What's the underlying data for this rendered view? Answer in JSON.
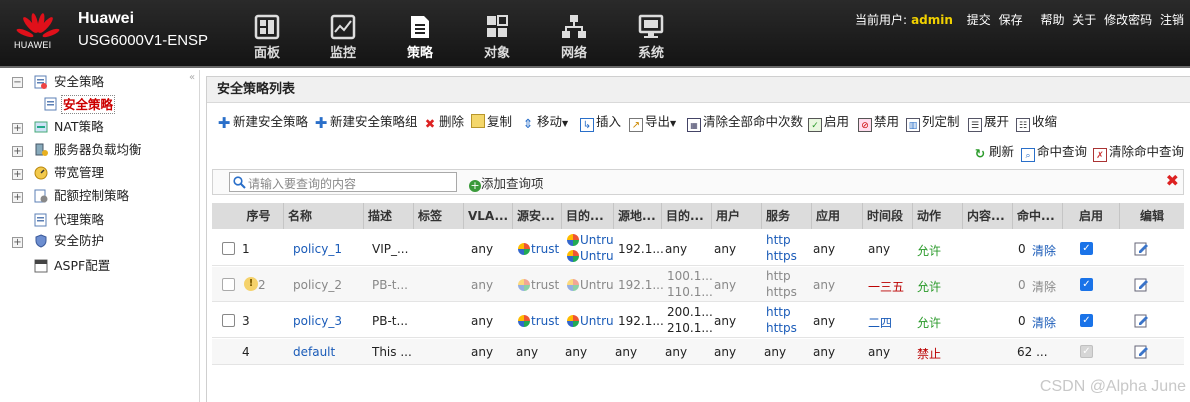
{
  "header": {
    "logo_text": "HUAWEI",
    "brand": "Huawei",
    "model": "USG6000V1-ENSP",
    "nav": [
      {
        "label": "面板",
        "icon": "dashboard-icon"
      },
      {
        "label": "监控",
        "icon": "monitor-icon"
      },
      {
        "label": "策略",
        "icon": "policy-icon"
      },
      {
        "label": "对象",
        "icon": "object-icon"
      },
      {
        "label": "网络",
        "icon": "network-icon"
      },
      {
        "label": "系统",
        "icon": "system-icon"
      }
    ],
    "current_user_label": "当前用户:",
    "current_user": "admin",
    "links": [
      "提交",
      "保存",
      "帮助",
      "关于",
      "修改密码",
      "注销"
    ]
  },
  "sidebar": {
    "items": [
      {
        "label": "安全策略",
        "expander": "−"
      },
      {
        "label": "安全策略",
        "selected": true
      },
      {
        "label": "NAT策略",
        "expander": "+"
      },
      {
        "label": "服务器负载均衡",
        "expander": "+"
      },
      {
        "label": "带宽管理",
        "expander": "+"
      },
      {
        "label": "配额控制策略",
        "expander": "+"
      },
      {
        "label": "代理策略",
        "expander": ""
      },
      {
        "label": "安全防护",
        "expander": "+"
      },
      {
        "label": "ASPF配置",
        "expander": ""
      }
    ]
  },
  "panel": {
    "title": "安全策略列表",
    "toolbar": [
      "新建安全策略",
      "新建安全策略组",
      "删除",
      "复制",
      "移动",
      "插入",
      "导出",
      "清除全部命中次数",
      "启用",
      "禁用",
      "列定制",
      "展开",
      "收缩"
    ],
    "toolbar2": [
      "刷新",
      "命中查询",
      "清除命中查询"
    ],
    "search_placeholder": "请输入要查询的内容",
    "add_query": "添加查询项",
    "columns": [
      "序号",
      "名称",
      "描述",
      "标签",
      "VLA...",
      "源安...",
      "目的...",
      "源地...",
      "目的...",
      "用户",
      "服务",
      "应用",
      "时间段",
      "动作",
      "内容...",
      "命中...",
      "启用",
      "编辑"
    ],
    "rows": [
      {
        "no": "1",
        "name": "policy_1",
        "desc": "VIP_...",
        "tag": "",
        "vlan": "any",
        "src_zone": "trust",
        "dst_zone": [
          "Untrust",
          "Untrust"
        ],
        "src_addr": "192.1...",
        "dst_addr": [
          "any"
        ],
        "user": "any",
        "service": [
          "http",
          "https"
        ],
        "app": "any",
        "time": "any",
        "action": "允许",
        "content": "",
        "hits": "0",
        "clear": "清除"
      },
      {
        "no": "2",
        "name": "policy_2",
        "desc": "PB-t...",
        "tag": "",
        "vlan": "any",
        "src_zone": "trust",
        "dst_zone": [
          "Untrust"
        ],
        "src_addr": "192.1...",
        "dst_addr": [
          "100.1...",
          "110.1..."
        ],
        "user": "any",
        "service": [
          "http",
          "https"
        ],
        "app": "any",
        "time": "一三五",
        "action": "允许",
        "content": "",
        "hits": "0",
        "clear": "清除"
      },
      {
        "no": "3",
        "name": "policy_3",
        "desc": "PB-t...",
        "tag": "",
        "vlan": "any",
        "src_zone": "trust",
        "dst_zone": [
          "Untrust"
        ],
        "src_addr": "192.1...",
        "dst_addr": [
          "200.1...",
          "210.1..."
        ],
        "user": "any",
        "service": [
          "http",
          "https"
        ],
        "app": "any",
        "time": "二四",
        "action": "允许",
        "content": "",
        "hits": "0",
        "clear": "清除"
      },
      {
        "no": "4",
        "name": "default",
        "desc": "This ...",
        "tag": "",
        "vlan": "any",
        "src_zone": "any",
        "dst_zone": [
          "any"
        ],
        "src_addr": "any",
        "dst_addr": [
          "any"
        ],
        "user": "any",
        "service": [
          "any"
        ],
        "app": "any",
        "time": "any",
        "action": "禁止",
        "content": "",
        "hits": "62 ...",
        "clear": ""
      }
    ]
  },
  "watermark": "CSDN @Alpha June"
}
